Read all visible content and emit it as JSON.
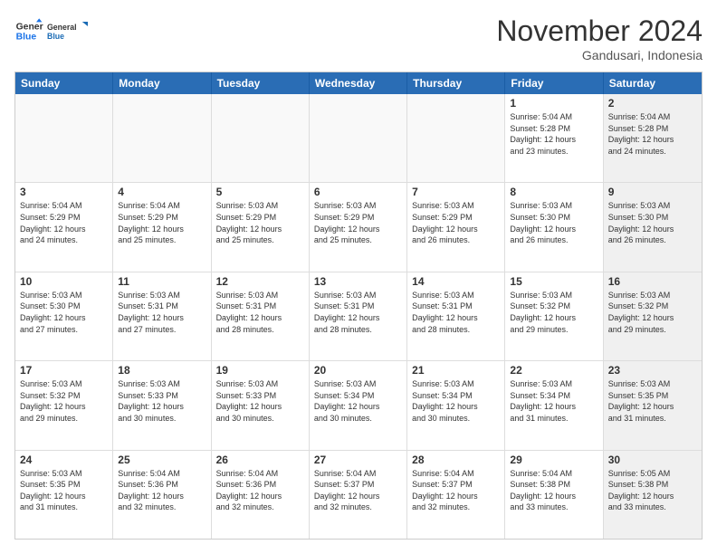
{
  "header": {
    "logo_line1": "General",
    "logo_line2": "Blue",
    "month": "November 2024",
    "location": "Gandusari, Indonesia"
  },
  "weekdays": [
    "Sunday",
    "Monday",
    "Tuesday",
    "Wednesday",
    "Thursday",
    "Friday",
    "Saturday"
  ],
  "rows": [
    [
      {
        "day": "",
        "info": "",
        "shaded": false,
        "empty": true
      },
      {
        "day": "",
        "info": "",
        "shaded": false,
        "empty": true
      },
      {
        "day": "",
        "info": "",
        "shaded": false,
        "empty": true
      },
      {
        "day": "",
        "info": "",
        "shaded": false,
        "empty": true
      },
      {
        "day": "",
        "info": "",
        "shaded": false,
        "empty": true
      },
      {
        "day": "1",
        "info": "Sunrise: 5:04 AM\nSunset: 5:28 PM\nDaylight: 12 hours\nand 23 minutes.",
        "shaded": false,
        "empty": false
      },
      {
        "day": "2",
        "info": "Sunrise: 5:04 AM\nSunset: 5:28 PM\nDaylight: 12 hours\nand 24 minutes.",
        "shaded": true,
        "empty": false
      }
    ],
    [
      {
        "day": "3",
        "info": "Sunrise: 5:04 AM\nSunset: 5:29 PM\nDaylight: 12 hours\nand 24 minutes.",
        "shaded": false,
        "empty": false
      },
      {
        "day": "4",
        "info": "Sunrise: 5:04 AM\nSunset: 5:29 PM\nDaylight: 12 hours\nand 25 minutes.",
        "shaded": false,
        "empty": false
      },
      {
        "day": "5",
        "info": "Sunrise: 5:03 AM\nSunset: 5:29 PM\nDaylight: 12 hours\nand 25 minutes.",
        "shaded": false,
        "empty": false
      },
      {
        "day": "6",
        "info": "Sunrise: 5:03 AM\nSunset: 5:29 PM\nDaylight: 12 hours\nand 25 minutes.",
        "shaded": false,
        "empty": false
      },
      {
        "day": "7",
        "info": "Sunrise: 5:03 AM\nSunset: 5:29 PM\nDaylight: 12 hours\nand 26 minutes.",
        "shaded": false,
        "empty": false
      },
      {
        "day": "8",
        "info": "Sunrise: 5:03 AM\nSunset: 5:30 PM\nDaylight: 12 hours\nand 26 minutes.",
        "shaded": false,
        "empty": false
      },
      {
        "day": "9",
        "info": "Sunrise: 5:03 AM\nSunset: 5:30 PM\nDaylight: 12 hours\nand 26 minutes.",
        "shaded": true,
        "empty": false
      }
    ],
    [
      {
        "day": "10",
        "info": "Sunrise: 5:03 AM\nSunset: 5:30 PM\nDaylight: 12 hours\nand 27 minutes.",
        "shaded": false,
        "empty": false
      },
      {
        "day": "11",
        "info": "Sunrise: 5:03 AM\nSunset: 5:31 PM\nDaylight: 12 hours\nand 27 minutes.",
        "shaded": false,
        "empty": false
      },
      {
        "day": "12",
        "info": "Sunrise: 5:03 AM\nSunset: 5:31 PM\nDaylight: 12 hours\nand 28 minutes.",
        "shaded": false,
        "empty": false
      },
      {
        "day": "13",
        "info": "Sunrise: 5:03 AM\nSunset: 5:31 PM\nDaylight: 12 hours\nand 28 minutes.",
        "shaded": false,
        "empty": false
      },
      {
        "day": "14",
        "info": "Sunrise: 5:03 AM\nSunset: 5:31 PM\nDaylight: 12 hours\nand 28 minutes.",
        "shaded": false,
        "empty": false
      },
      {
        "day": "15",
        "info": "Sunrise: 5:03 AM\nSunset: 5:32 PM\nDaylight: 12 hours\nand 29 minutes.",
        "shaded": false,
        "empty": false
      },
      {
        "day": "16",
        "info": "Sunrise: 5:03 AM\nSunset: 5:32 PM\nDaylight: 12 hours\nand 29 minutes.",
        "shaded": true,
        "empty": false
      }
    ],
    [
      {
        "day": "17",
        "info": "Sunrise: 5:03 AM\nSunset: 5:32 PM\nDaylight: 12 hours\nand 29 minutes.",
        "shaded": false,
        "empty": false
      },
      {
        "day": "18",
        "info": "Sunrise: 5:03 AM\nSunset: 5:33 PM\nDaylight: 12 hours\nand 30 minutes.",
        "shaded": false,
        "empty": false
      },
      {
        "day": "19",
        "info": "Sunrise: 5:03 AM\nSunset: 5:33 PM\nDaylight: 12 hours\nand 30 minutes.",
        "shaded": false,
        "empty": false
      },
      {
        "day": "20",
        "info": "Sunrise: 5:03 AM\nSunset: 5:34 PM\nDaylight: 12 hours\nand 30 minutes.",
        "shaded": false,
        "empty": false
      },
      {
        "day": "21",
        "info": "Sunrise: 5:03 AM\nSunset: 5:34 PM\nDaylight: 12 hours\nand 30 minutes.",
        "shaded": false,
        "empty": false
      },
      {
        "day": "22",
        "info": "Sunrise: 5:03 AM\nSunset: 5:34 PM\nDaylight: 12 hours\nand 31 minutes.",
        "shaded": false,
        "empty": false
      },
      {
        "day": "23",
        "info": "Sunrise: 5:03 AM\nSunset: 5:35 PM\nDaylight: 12 hours\nand 31 minutes.",
        "shaded": true,
        "empty": false
      }
    ],
    [
      {
        "day": "24",
        "info": "Sunrise: 5:03 AM\nSunset: 5:35 PM\nDaylight: 12 hours\nand 31 minutes.",
        "shaded": false,
        "empty": false
      },
      {
        "day": "25",
        "info": "Sunrise: 5:04 AM\nSunset: 5:36 PM\nDaylight: 12 hours\nand 32 minutes.",
        "shaded": false,
        "empty": false
      },
      {
        "day": "26",
        "info": "Sunrise: 5:04 AM\nSunset: 5:36 PM\nDaylight: 12 hours\nand 32 minutes.",
        "shaded": false,
        "empty": false
      },
      {
        "day": "27",
        "info": "Sunrise: 5:04 AM\nSunset: 5:37 PM\nDaylight: 12 hours\nand 32 minutes.",
        "shaded": false,
        "empty": false
      },
      {
        "day": "28",
        "info": "Sunrise: 5:04 AM\nSunset: 5:37 PM\nDaylight: 12 hours\nand 32 minutes.",
        "shaded": false,
        "empty": false
      },
      {
        "day": "29",
        "info": "Sunrise: 5:04 AM\nSunset: 5:38 PM\nDaylight: 12 hours\nand 33 minutes.",
        "shaded": false,
        "empty": false
      },
      {
        "day": "30",
        "info": "Sunrise: 5:05 AM\nSunset: 5:38 PM\nDaylight: 12 hours\nand 33 minutes.",
        "shaded": true,
        "empty": false
      }
    ]
  ]
}
